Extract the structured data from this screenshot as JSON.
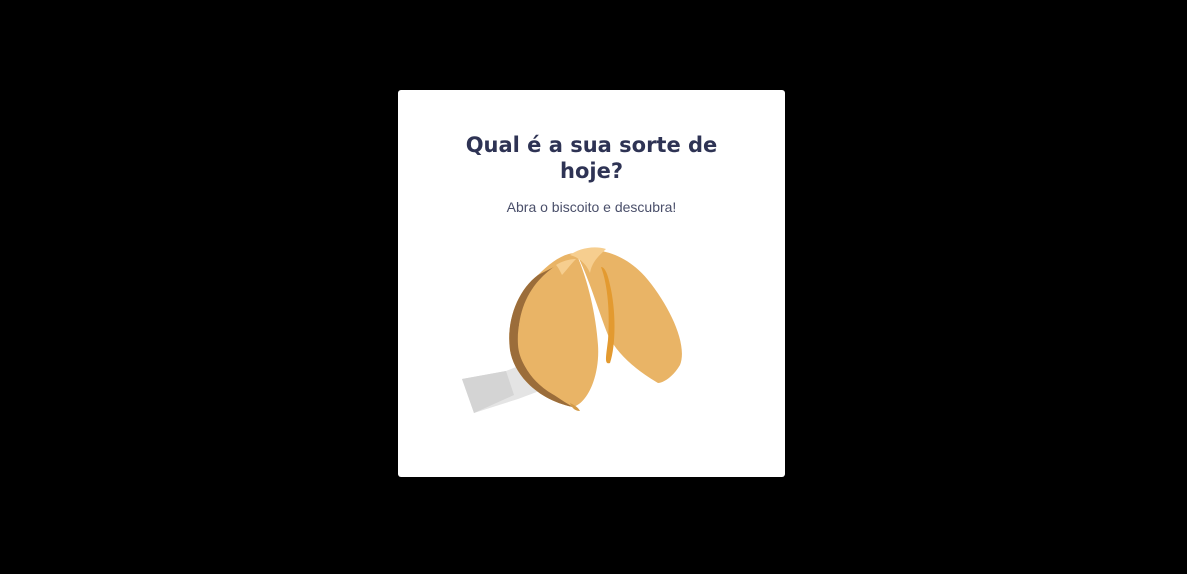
{
  "modal": {
    "title": "Qual é a sua sorte de hoje?",
    "subtitle": "Abra o biscoito e descubra!"
  },
  "cookie": {
    "icon": "fortune-cookie-icon",
    "colors": {
      "shell": "#e9b466",
      "shell_inner": "#e39a30",
      "shell_edge": "#9b6d3a",
      "highlight": "#f6ce8f",
      "paper": "#e4e4e4",
      "paper_shade": "#c9c9c9"
    }
  },
  "colors": {
    "backdrop": "#000000",
    "card": "#ffffff",
    "title": "#2e3354",
    "subtitle": "#4a4f6a"
  }
}
